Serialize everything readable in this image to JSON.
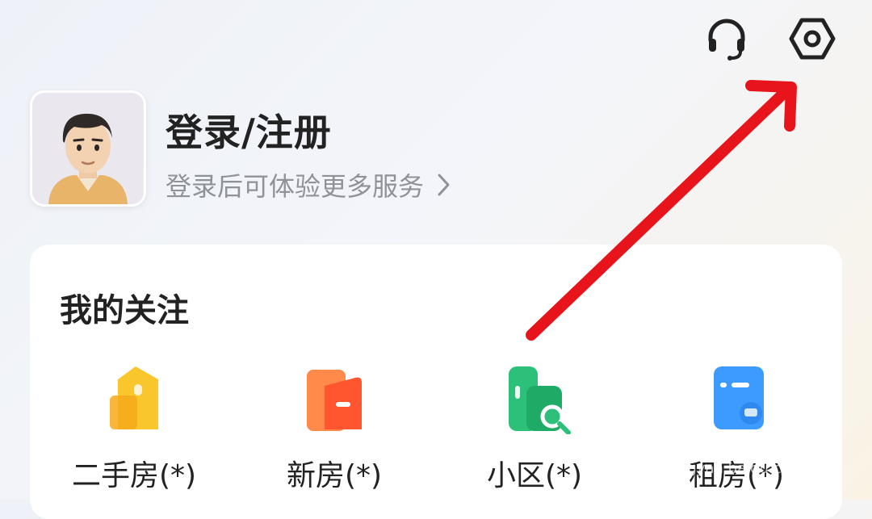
{
  "header": {
    "icons": [
      "headset-icon",
      "settings-icon"
    ]
  },
  "profile": {
    "title": "登录/注册",
    "subtitle": "登录后可体验更多服务",
    "chevron": ">"
  },
  "favorites": {
    "title": "我的关注",
    "items": [
      {
        "label": "二手房(*)",
        "icon": "second-hand-house-icon",
        "color": "#f9c62b"
      },
      {
        "label": "新房(*)",
        "icon": "new-house-icon",
        "color": "#ff6a3d"
      },
      {
        "label": "小区(*)",
        "icon": "community-icon",
        "color": "#2cc07a"
      },
      {
        "label": "租房(*)",
        "icon": "rental-icon",
        "color": "#3d9bff"
      }
    ]
  },
  "annotation": {
    "arrow_color": "#e8141b"
  },
  "watermark": {
    "text": "Baidu经验",
    "sub": "jingyan.baidu.com"
  }
}
